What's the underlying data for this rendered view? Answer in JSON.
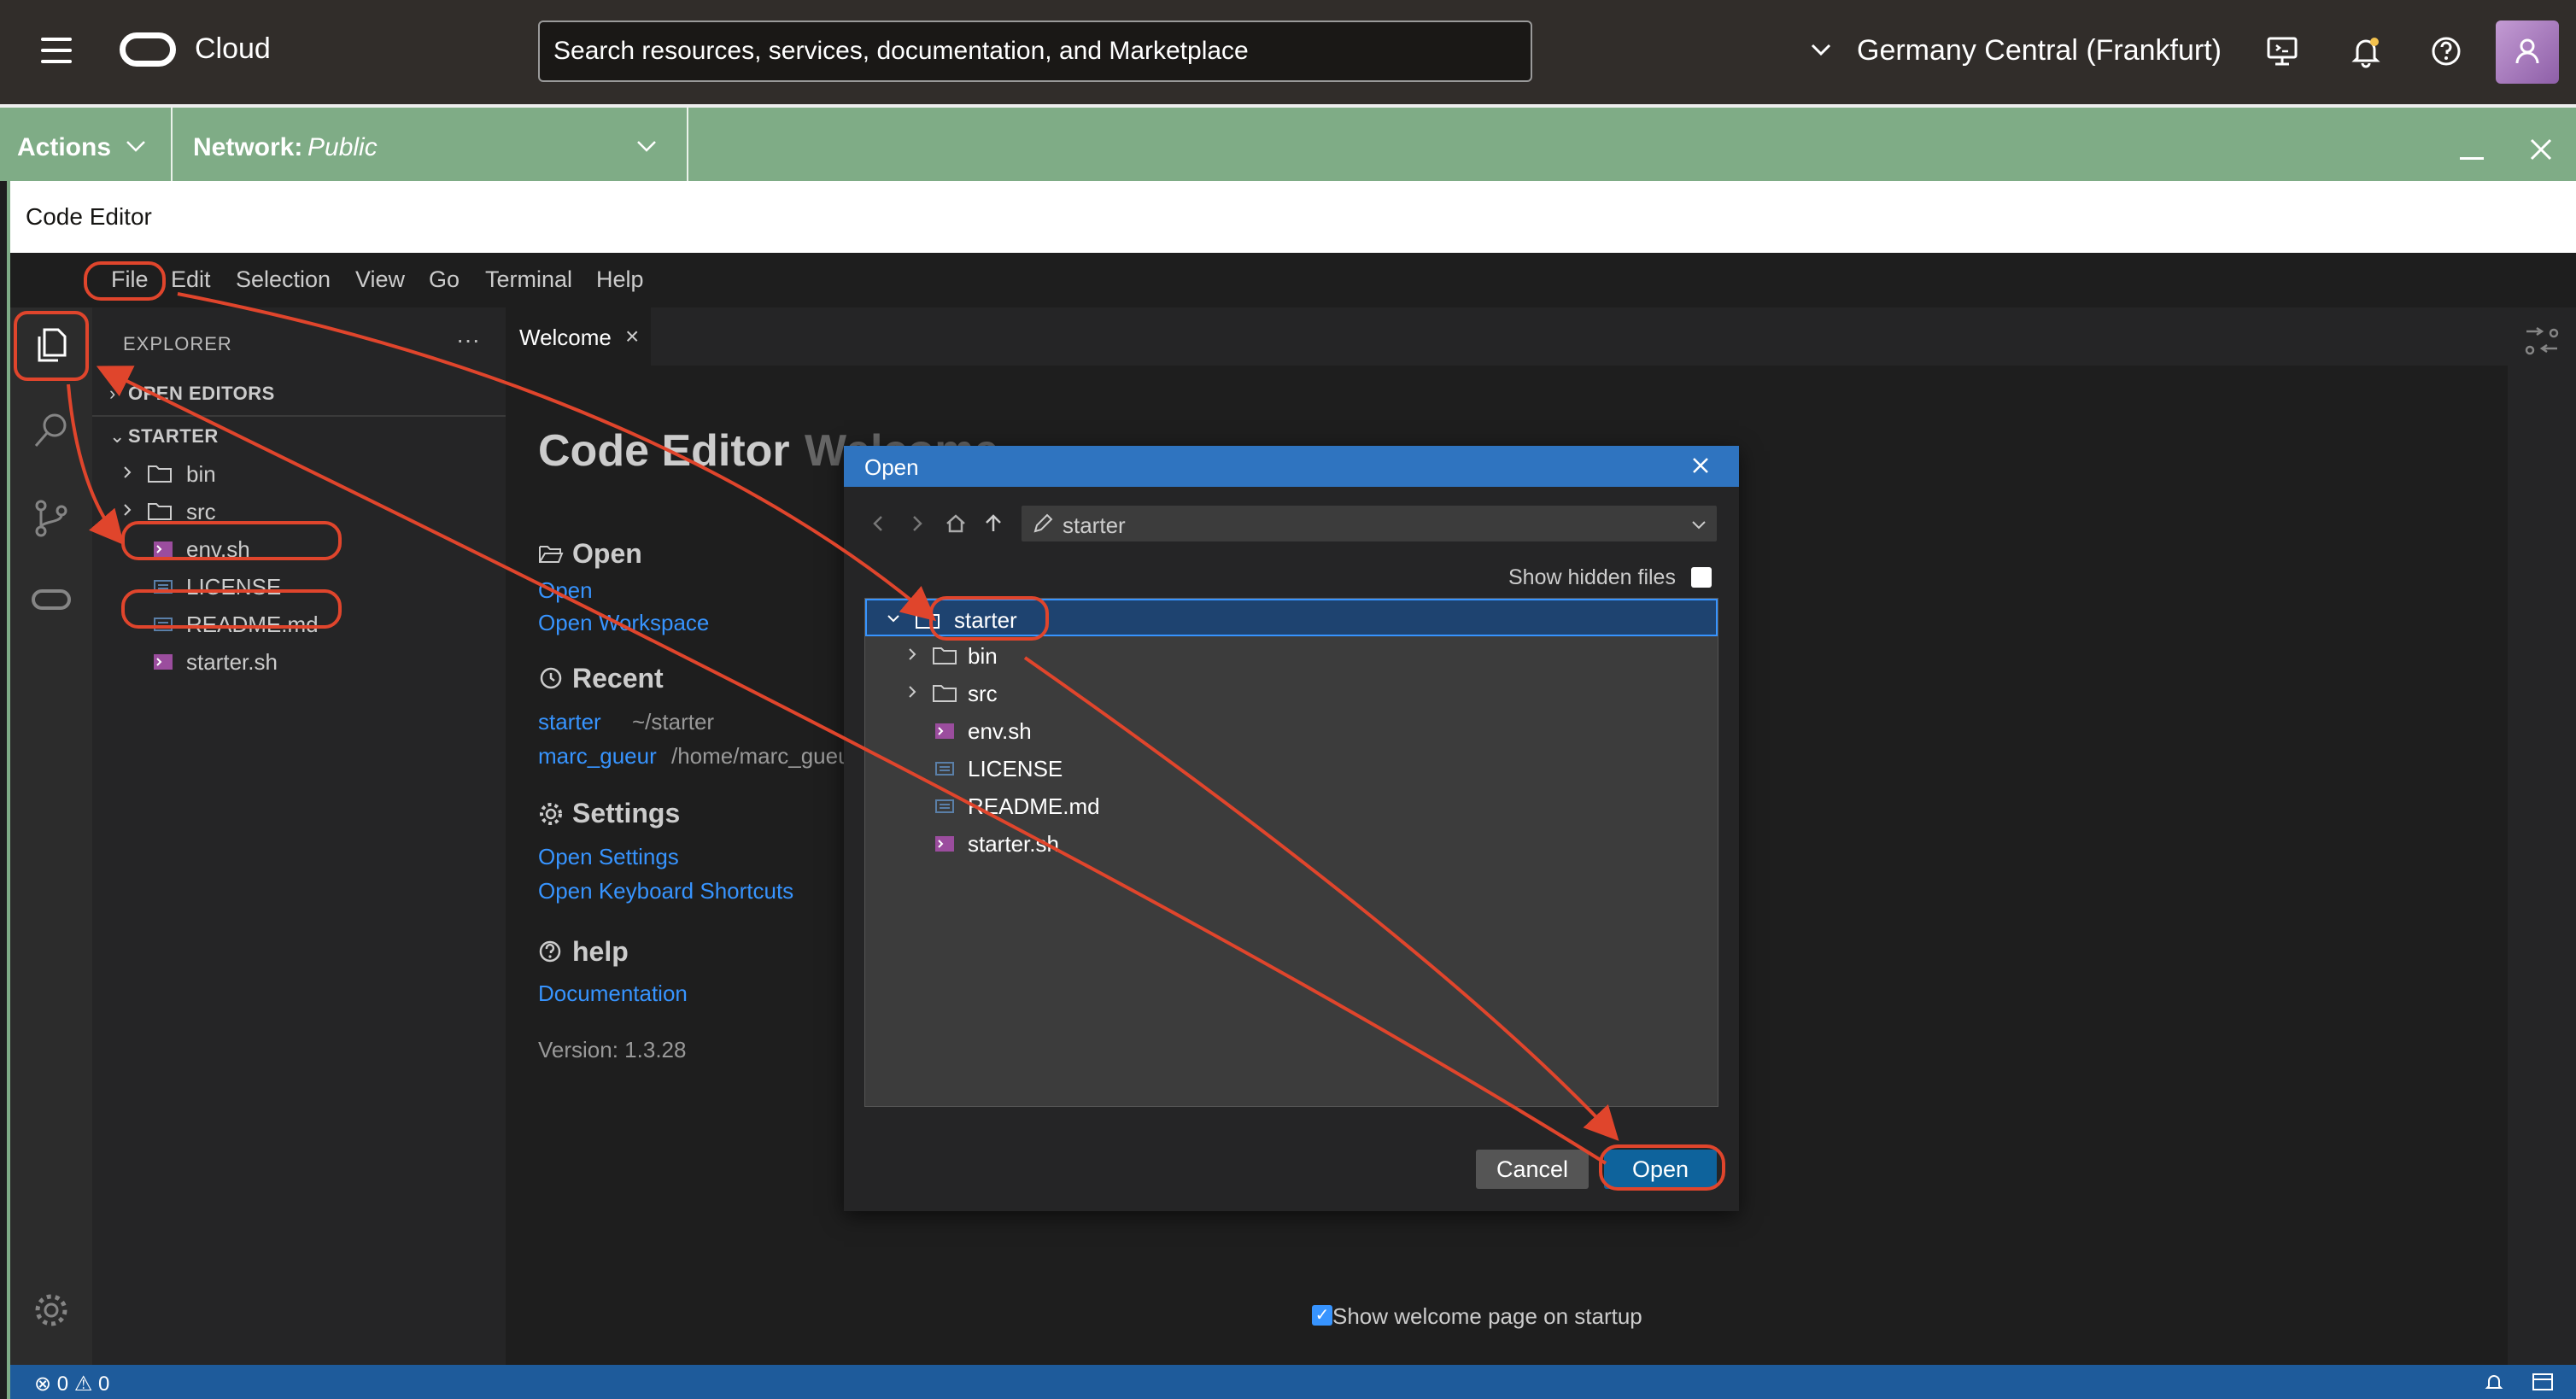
{
  "topbar": {
    "brand": "Cloud",
    "search_placeholder": "Search resources, services, documentation, and Marketplace",
    "region": "Germany Central (Frankfurt)"
  },
  "actionbar": {
    "actions_label": "Actions",
    "network_label": "Network:",
    "network_value": "Public"
  },
  "code_editor": {
    "title": "Code Editor",
    "menu": [
      "File",
      "Edit",
      "Selection",
      "View",
      "Go",
      "Terminal",
      "Help"
    ],
    "explorer": {
      "title": "EXPLORER",
      "more": "···",
      "open_editors": "OPEN EDITORS",
      "folder": "STARTER",
      "items": [
        {
          "label": "bin",
          "type": "folder"
        },
        {
          "label": "src",
          "type": "folder"
        },
        {
          "label": "env.sh",
          "type": "shell"
        },
        {
          "label": "LICENSE",
          "type": "text"
        },
        {
          "label": "README.md",
          "type": "text"
        },
        {
          "label": "starter.sh",
          "type": "shell"
        }
      ]
    },
    "tab": {
      "label": "Welcome",
      "close": "×"
    },
    "welcome": {
      "title": "Code Editor",
      "title_rest": "Welcome",
      "open_heading": "Open",
      "open_link": "Open",
      "open_workspace_link": "Open Workspace",
      "recent_heading": "Recent",
      "recent": [
        {
          "name": "starter",
          "path": "~/starter"
        },
        {
          "name": "marc_gueur",
          "path": "/home/marc_gueu"
        }
      ],
      "settings_heading": "Settings",
      "open_settings": "Open Settings",
      "open_shortcuts": "Open Keyboard Shortcuts",
      "help_heading": "help",
      "documentation": "Documentation",
      "version": "Version: 1.3.28",
      "show_on_startup": "Show welcome page on startup"
    },
    "status": {
      "errors": "0",
      "warnings": "0"
    }
  },
  "dialog": {
    "title": "Open",
    "path": "starter",
    "show_hidden_label": "Show hidden files",
    "tree": [
      {
        "label": "starter",
        "type": "folder",
        "expanded": true,
        "selected": true
      },
      {
        "label": "bin",
        "type": "folder"
      },
      {
        "label": "src",
        "type": "folder"
      },
      {
        "label": "env.sh",
        "type": "shell"
      },
      {
        "label": "LICENSE",
        "type": "text"
      },
      {
        "label": "README.md",
        "type": "text"
      },
      {
        "label": "starter.sh",
        "type": "shell"
      }
    ],
    "cancel_label": "Cancel",
    "open_label": "Open"
  },
  "colors": {
    "topbar": "#312d2a",
    "actionbar": "#7fac86",
    "dialog_title": "#2f74c0",
    "link": "#3794ff",
    "annotation": "#e0452c",
    "statusbar": "#1e5b9b"
  }
}
